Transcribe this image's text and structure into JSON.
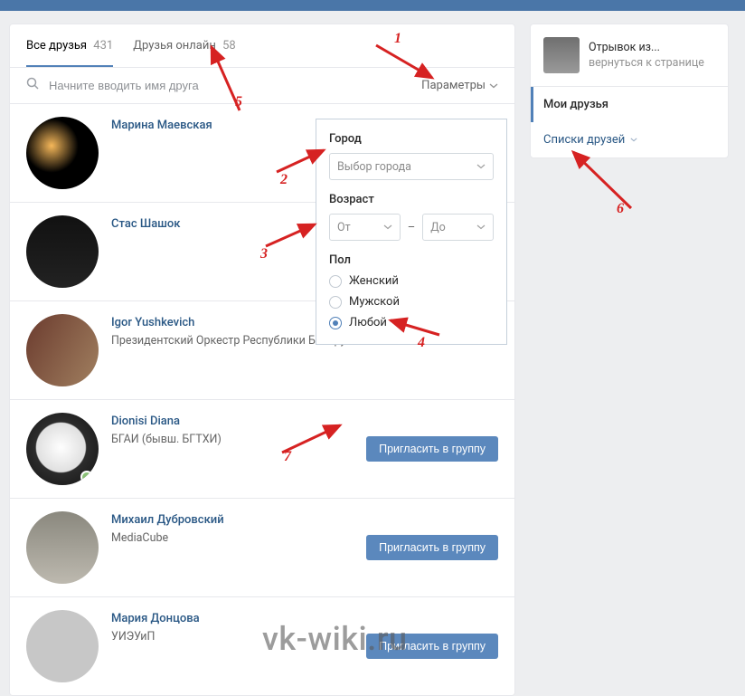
{
  "tabs": {
    "all": {
      "label": "Все друзья",
      "count": "431"
    },
    "online": {
      "label": "Друзья онлайн",
      "count": "58"
    }
  },
  "search": {
    "placeholder": "Начните вводить имя друга",
    "params_label": "Параметры"
  },
  "filter": {
    "city_label": "Город",
    "city_placeholder": "Выбор города",
    "age_label": "Возраст",
    "age_from": "От",
    "age_to": "До",
    "gender_label": "Пол",
    "gender_female": "Женский",
    "gender_male": "Мужской",
    "gender_any": "Любой"
  },
  "friends": [
    {
      "name": "Марина Маевская",
      "sub": "",
      "invite": false,
      "online": false
    },
    {
      "name": "Стас Шашок",
      "sub": "",
      "invite": false,
      "online": false
    },
    {
      "name": "Igor Yushkevich",
      "sub": "Президентский Оркестр Республики Беларусь",
      "invite": false,
      "online": false
    },
    {
      "name": "Dionisi Diana",
      "sub": "БГАИ (бывш. БГТХИ)",
      "invite": true,
      "online": true
    },
    {
      "name": "Михаил Дубровский",
      "sub": "MediaCube",
      "invite": true,
      "online": false
    },
    {
      "name": "Мария Донцова",
      "sub": "УИЭУиП",
      "invite": true,
      "online": false
    }
  ],
  "invite_label": "Пригласить в группу",
  "sidebar": {
    "profile_title": "Отрывок из...",
    "profile_back": "вернуться к странице",
    "item_friends": "Мои друзья",
    "item_lists": "Списки друзей"
  },
  "annotations": [
    "1",
    "2",
    "3",
    "4",
    "5",
    "6",
    "7"
  ],
  "watermark": "vk-wiki.ru"
}
